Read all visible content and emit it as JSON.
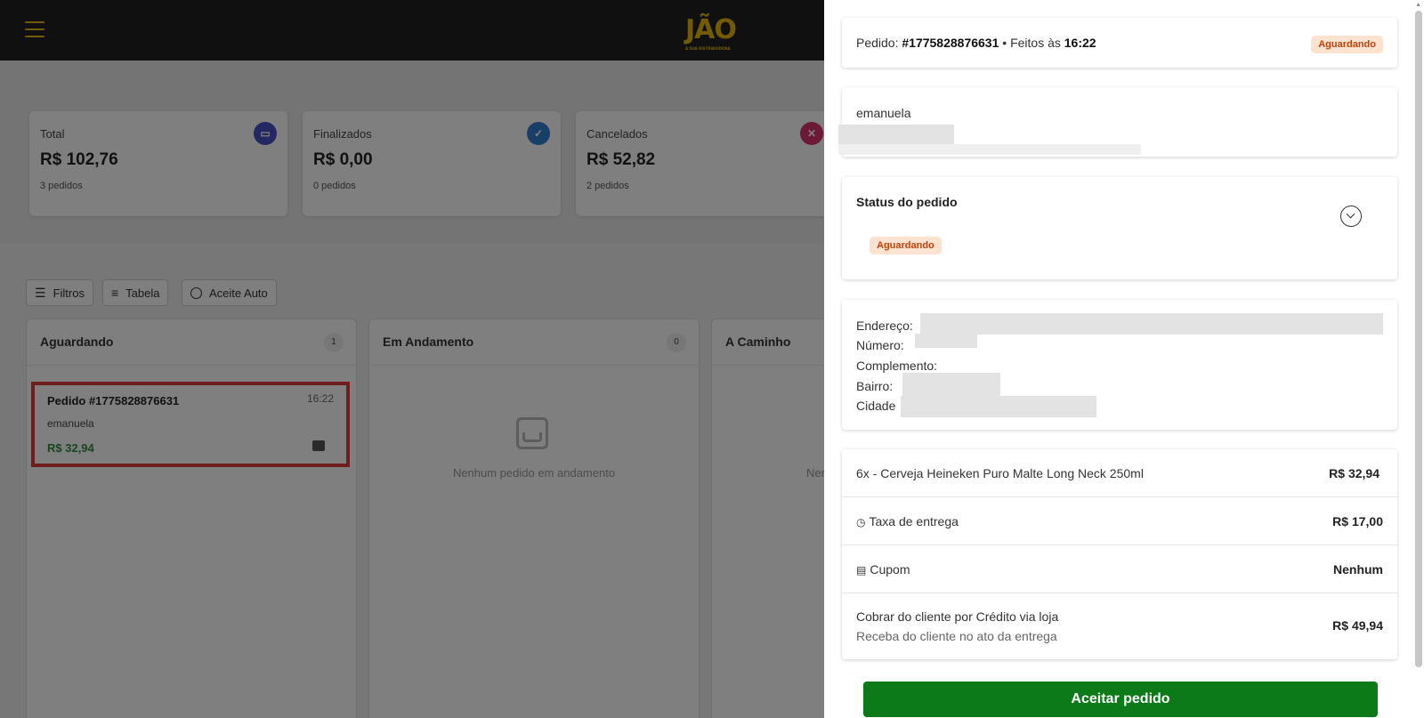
{
  "header": {
    "logo": "JÃO",
    "logo_tagline": "A SUA DISTRIBUIDORA"
  },
  "stats": [
    {
      "label": "Total",
      "value": "R$ 102,76",
      "sub": "3 pedidos",
      "icon": "money-icon",
      "color": "#4b4fc4"
    },
    {
      "label": "Finalizados",
      "value": "R$ 0,00",
      "sub": "0 pedidos",
      "icon": "check-icon",
      "color": "#2f7fd1"
    },
    {
      "label": "Cancelados",
      "value": "R$ 52,82",
      "sub": "2 pedidos",
      "icon": "cancel-icon",
      "color": "#d6336c"
    }
  ],
  "toolbar": {
    "filters": "Filtros",
    "table": "Tabela",
    "auto_accept": "Aceite Auto"
  },
  "columns": [
    {
      "title": "Aguardando",
      "count": "1"
    },
    {
      "title": "Em Andamento",
      "count": "0",
      "empty": "Nenhum pedido em andamento"
    },
    {
      "title": "A Caminho",
      "empty": "Ner"
    }
  ],
  "order_card": {
    "title": "Pedido #1775828876631",
    "time": "16:22",
    "customer": "emanuela",
    "price": "R$ 32,94"
  },
  "drawer": {
    "order_prefix": "Pedido: ",
    "order_id": "#1775828876631",
    "made_at_prefix": " • Feitos às ",
    "made_at": "16:22",
    "status_badge": "Aguardando",
    "customer_name": "emanuela",
    "status_title": "Status do pedido",
    "status_value": "Aguardando",
    "address": {
      "street_label": "Endereço:",
      "number_label": "Número:",
      "complement_label": "Complemento:",
      "district_label": "Bairro:",
      "city_label": "Cidade"
    },
    "item": {
      "label": "6x - Cerveja Heineken Puro Malte Long Neck 250ml",
      "value": "R$ 32,94"
    },
    "delivery": {
      "label": "Taxa de entrega",
      "value": "R$ 17,00"
    },
    "coupon": {
      "label": "Cupom",
      "value": "Nenhum"
    },
    "charge": {
      "label": "Cobrar do cliente por Crédito via loja",
      "sub": "Receba do cliente no ato da entrega",
      "value": "R$ 49,94"
    },
    "accept_button": "Aceitar pedido"
  }
}
